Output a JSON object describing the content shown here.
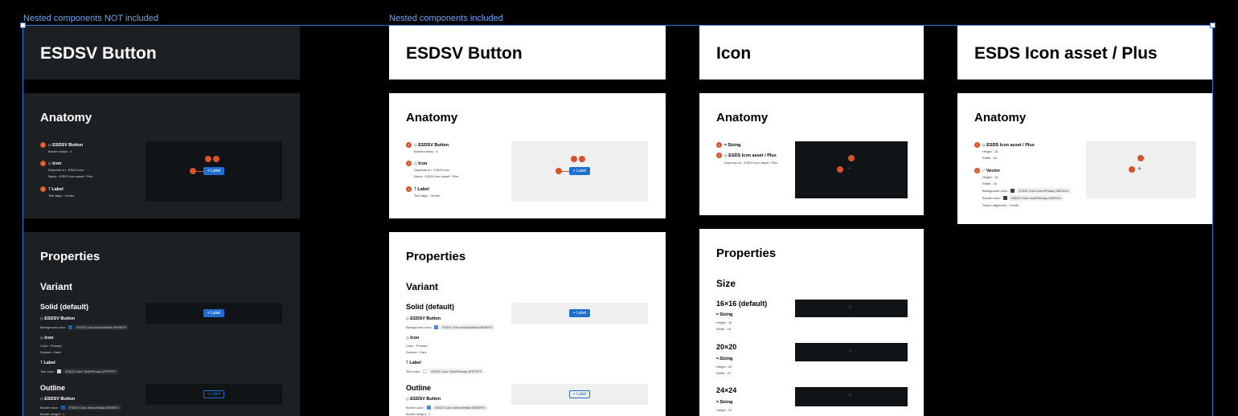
{
  "labels": {
    "not_included": "Nested components NOT included",
    "included": "Nested components included"
  },
  "colors": {
    "selection": "#2f7ae5",
    "dark_panel": "#1c2022",
    "accent_blue": "#1f6fd1",
    "pin": "#d9532a"
  },
  "panels": {
    "dark_button": {
      "title": "ESDSV Button",
      "anatomy": "Anatomy",
      "properties": "Properties",
      "variant": "Variant",
      "solid": "Solid (default)",
      "outline": "Outline"
    },
    "light_button": {
      "title": "ESDSV Button",
      "anatomy": "Anatomy",
      "properties": "Properties",
      "variant": "Variant",
      "solid": "Solid (default)",
      "outline": "Outline"
    },
    "icon": {
      "title": "Icon",
      "anatomy": "Anatomy",
      "properties": "Properties",
      "size": "Size",
      "size_16": "16×16 (default)",
      "size_20": "20×20",
      "size_24": "24×24"
    },
    "icon_asset": {
      "title": "ESDS Icon asset / Plus",
      "anatomy": "Anatomy"
    }
  },
  "anatomy_button": {
    "item1": "ESDSV Button",
    "item1_sub": "Border radius : 4",
    "item2": "Icon",
    "item2_sub1": "Depends on : ESDS Icon",
    "item2_sub2": "Name : ESDS Icon asset / Plus",
    "item3": "Label",
    "item3_sub": "Text align : Center",
    "button_label": "+ Label"
  },
  "variant_solid": {
    "item1": "ESDSV Button",
    "item1_sub": "Background color :",
    "item1_chip": "ESDS Color Action/Initial #0E5EF4",
    "item2": "Icon",
    "item2_sub1": "Color : Primary",
    "item2_sub2": "Surface : Dark",
    "item3": "Label",
    "item3_sub": "Text color :",
    "item3_chip": "ESDS Color Text/Primary #FFFFFF",
    "button_label": "+ Label"
  },
  "variant_outline": {
    "item1": "ESDSV Button",
    "item1_sub": "Border color :",
    "item1_chip": "ESDS Color Action/Initial #0E5EF4",
    "item1_sub2": "Border weight : 1",
    "button_label": "+ Label"
  },
  "anatomy_icon": {
    "item1": "Sizing",
    "item2": "ESDS Icon asset / Plus",
    "item2_sub": "Depends on : ESDS Icon asset / Plus"
  },
  "icon_sizes": {
    "sizing": "Sizing",
    "s16_h": "Height : 16",
    "s16_w": "Width : 16",
    "s20_h": "Height : 20",
    "s20_w": "Width : 20",
    "s24_h": "Height : 24"
  },
  "anatomy_asset": {
    "item1": "ESDS Icon asset / Plus",
    "item1_h": "Height : 16",
    "item1_w": "Width : 16",
    "item2": "Vector",
    "item2_h": "Height : 16",
    "item2_w": "Width : 16",
    "item2_bg": "Background color :",
    "item2_bg_chip": "ESDS Color Icon/Primary #0E1114",
    "item2_border": "Border color :",
    "item2_border_chip": "ESDS Color Icon/Primary #0E1114",
    "item2_stroke": "Stroke alignment : Center"
  },
  "icons": {
    "component": "diamond-icon",
    "label": "text-icon",
    "sizing": "frame-icon",
    "vector": "vector-icon",
    "plus": "plus-icon"
  }
}
